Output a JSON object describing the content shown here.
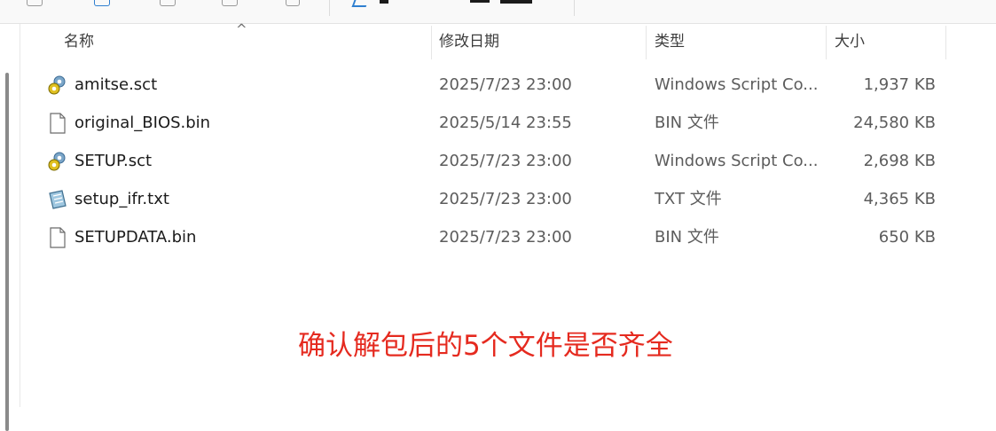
{
  "columns": {
    "name": "名称",
    "date": "修改日期",
    "type": "类型",
    "size": "大小"
  },
  "files": [
    {
      "name": "amitse.sct",
      "date": "2025/7/23 23:00",
      "type": "Windows Script Co...",
      "size": "1,937 KB",
      "icon": "script-file-icon"
    },
    {
      "name": "original_BIOS.bin",
      "date": "2025/5/14 23:55",
      "type": "BIN 文件",
      "size": "24,580 KB",
      "icon": "blank-file-icon"
    },
    {
      "name": "SETUP.sct",
      "date": "2025/7/23 23:00",
      "type": "Windows Script Co...",
      "size": "2,698 KB",
      "icon": "script-file-icon"
    },
    {
      "name": "setup_ifr.txt",
      "date": "2025/7/23 23:00",
      "type": "TXT 文件",
      "size": "4,365 KB",
      "icon": "text-file-icon"
    },
    {
      "name": "SETUPDATA.bin",
      "date": "2025/7/23 23:00",
      "type": "BIN 文件",
      "size": "650 KB",
      "icon": "blank-file-icon"
    }
  ],
  "annotation": "确认解包后的5个文件是否齐全",
  "colors": {
    "annotation": "#e52a1f",
    "secondary_text": "#5c5c5c",
    "header_text": "#3d3d3d"
  }
}
